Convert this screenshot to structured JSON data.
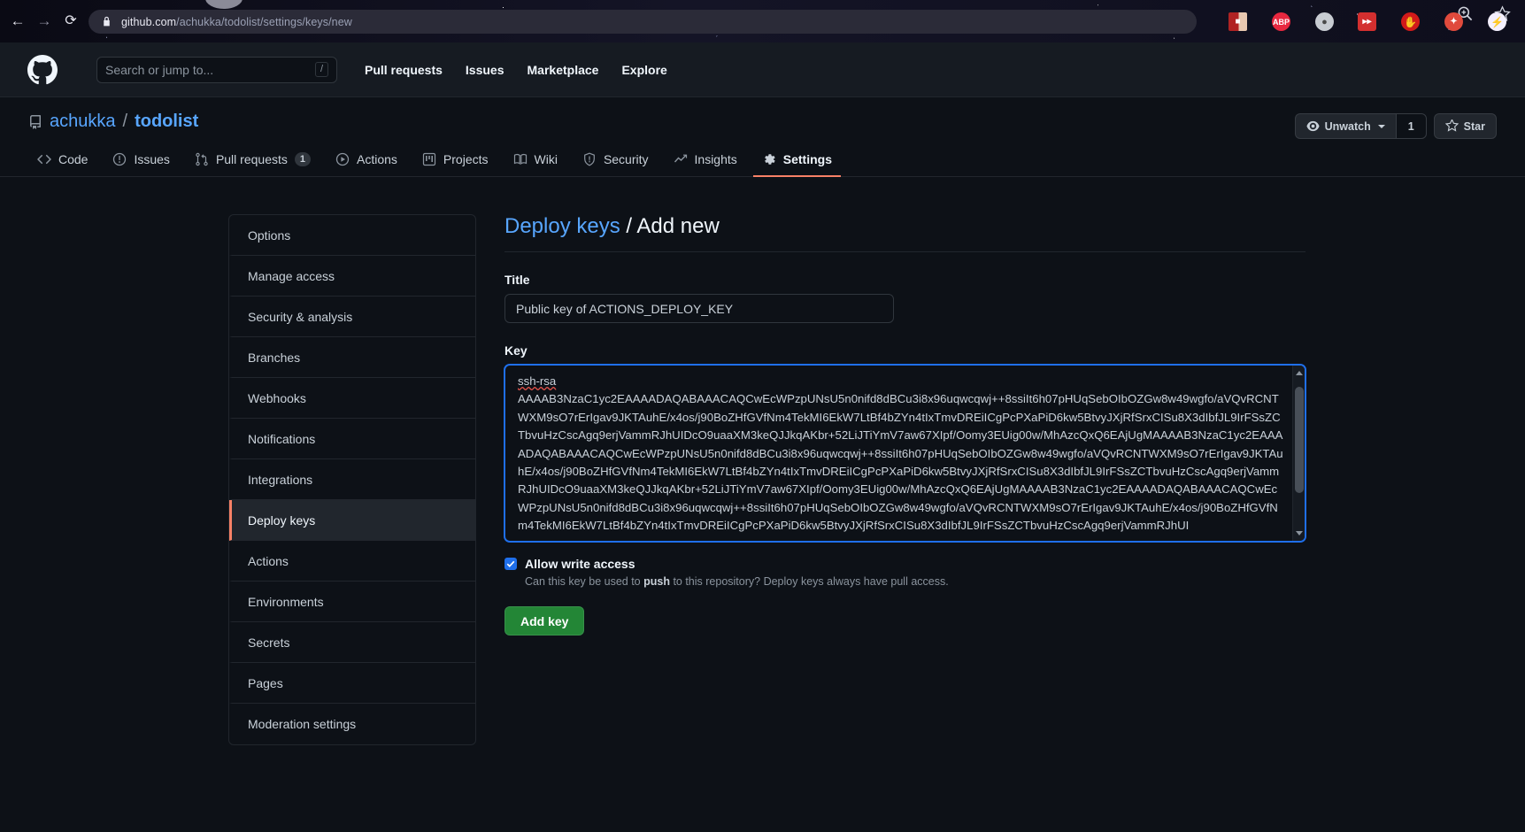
{
  "browser": {
    "back_icon": "back-arrow-icon",
    "forward_icon": "forward-arrow-icon",
    "reload_icon": "reload-icon",
    "url_domain": "github.com",
    "url_path": "/achukka/todolist/settings/keys/new",
    "lock_icon": "lock-icon",
    "zoom_icon": "zoom-search-icon",
    "bookmark_icon": "star-bookmark-icon",
    "extensions": [
      {
        "name": "red-book-extension-icon",
        "label": "",
        "color": "#c42b2b"
      },
      {
        "name": "adblock-plus-extension-icon",
        "label": "ABP",
        "color": "#e8283f"
      },
      {
        "name": "gray-circle-extension-icon",
        "label": "",
        "color": "#9aa0a6"
      },
      {
        "name": "fast-forward-extension-icon",
        "label": "",
        "color": "#d32f2f"
      },
      {
        "name": "stop-hand-extension-icon",
        "label": "",
        "color": "#d21a1a"
      },
      {
        "name": "red-dot-extension-icon",
        "label": "",
        "color": "#e04a3c"
      },
      {
        "name": "lightning-extension-icon",
        "label": "",
        "color": "#f0f0ff"
      }
    ]
  },
  "header": {
    "logo_icon": "github-mark-icon",
    "search_placeholder": "Search or jump to...",
    "search_shortcut": "/",
    "nav": [
      {
        "label": "Pull requests"
      },
      {
        "label": "Issues"
      },
      {
        "label": "Marketplace"
      },
      {
        "label": "Explore"
      }
    ]
  },
  "repo": {
    "icon": "repo-book-icon",
    "owner": "achukka",
    "separator": "/",
    "name": "todolist",
    "watch_label": "Unwatch",
    "watch_count": "1",
    "star_label": "Star",
    "tabs": [
      {
        "label": "Code",
        "icon": "code-icon",
        "badge": "",
        "active": false
      },
      {
        "label": "Issues",
        "icon": "issue-opened-icon",
        "badge": "",
        "active": false
      },
      {
        "label": "Pull requests",
        "icon": "git-pull-request-icon",
        "badge": "1",
        "active": false
      },
      {
        "label": "Actions",
        "icon": "play-icon",
        "badge": "",
        "active": false
      },
      {
        "label": "Projects",
        "icon": "project-board-icon",
        "badge": "",
        "active": false
      },
      {
        "label": "Wiki",
        "icon": "book-icon",
        "badge": "",
        "active": false
      },
      {
        "label": "Security",
        "icon": "shield-icon",
        "badge": "",
        "active": false
      },
      {
        "label": "Insights",
        "icon": "graph-icon",
        "badge": "",
        "active": false
      },
      {
        "label": "Settings",
        "icon": "gear-icon",
        "badge": "",
        "active": true
      }
    ]
  },
  "sidebar": {
    "items": [
      {
        "label": "Options",
        "active": false
      },
      {
        "label": "Manage access",
        "active": false
      },
      {
        "label": "Security & analysis",
        "active": false
      },
      {
        "label": "Branches",
        "active": false
      },
      {
        "label": "Webhooks",
        "active": false
      },
      {
        "label": "Notifications",
        "active": false
      },
      {
        "label": "Integrations",
        "active": false
      },
      {
        "label": "Deploy keys",
        "active": true
      },
      {
        "label": "Actions",
        "active": false
      },
      {
        "label": "Environments",
        "active": false
      },
      {
        "label": "Secrets",
        "active": false
      },
      {
        "label": "Pages",
        "active": false
      },
      {
        "label": "Moderation settings",
        "active": false
      }
    ]
  },
  "main": {
    "heading_link": "Deploy keys",
    "heading_separator": " / ",
    "heading_current": "Add new",
    "title_label": "Title",
    "title_value": "Public key of ACTIONS_DEPLOY_KEY",
    "title_placeholder": "",
    "key_label": "Key",
    "key_prefix": "ssh-rsa",
    "key_body": "AAAAB3NzaC1yc2EAAAADAQABAAACAQCwEcWPzpUNsU5n0nifd8dBCu3i8x96uqwcqwj++8ssiIt6h07pHUqSebOIbOZGw8w49wgfo/aVQvRCNTWXM9sO7rErIgav9JKTAuhE/x4os/j90BoZHfGVfNm4TekMI6EkW7LtBf4bZYn4tIxTmvDREiICgPcPXaPiD6kw5BtvyJXjRfSrxCISu8X3dIbfJL9IrFSsZCTbvuHzCscAgq9erjVammRJhUIDcO9uaaXM3keQJJkqAKbr+52LiJTiYmV7aw67XIpf/Oomy3EUig00w/MhAzcQxQ6EAjUgMAAAAB3NzaC1yc2EAAAADAQABAAACAQCwEcWPzpUNsU5n0nifd8dBCu3i8x96uqwcqwj++8ssiIt6h07pHUqSebOIbOZGw8w49wgfo/aVQvRCNTWXM9sO7rErIgav9JKTAuhE/x4os/j90BoZHfGVfNm4TekMI6EkW7LtBf4bZYn4tIxTmvDREiICgPcPXaPiD6kw5BtvyJXjRfSrxCISu8X3dIbfJL9IrFSsZCTbvuHzCscAgq9erjVammRJhUIDcO9uaaXM3keQJJkqAKbr+52LiJTiYmV7aw67XIpf/Oomy3EUig00w/MhAzcQxQ6EAjUgMAAAAB3NzaC1yc2EAAAADAQABAAACAQCwEcWPzpUNsU5n0nifd8dBCu3i8x96uqwcqwj++8ssiIt6h07pHUqSebOIbOZGw8w49wgfo/aVQvRCNTWXM9sO7rErIgav9JKTAuhE/x4os/j90BoZHfGVfNm4TekMI6EkW7LtBf4bZYn4tIxTmvDREiICgPcPXaPiD6kw5BtvyJXjRfSrxCISu8X3dIbfJL9IrFSsZCTbvuHzCscAgq9erjVammRJhUI",
    "write_access_label": "Allow write access",
    "write_access_checked": true,
    "write_access_note_before": "Can this key be used to ",
    "write_access_note_bold": "push",
    "write_access_note_after": " to this repository? Deploy keys always have pull access.",
    "submit_label": "Add key"
  },
  "colors": {
    "accent_blue": "#58a6ff",
    "focus_blue": "#1f6feb",
    "active_orange": "#f78166",
    "green_button": "#238636",
    "page_bg": "#0d1117"
  }
}
